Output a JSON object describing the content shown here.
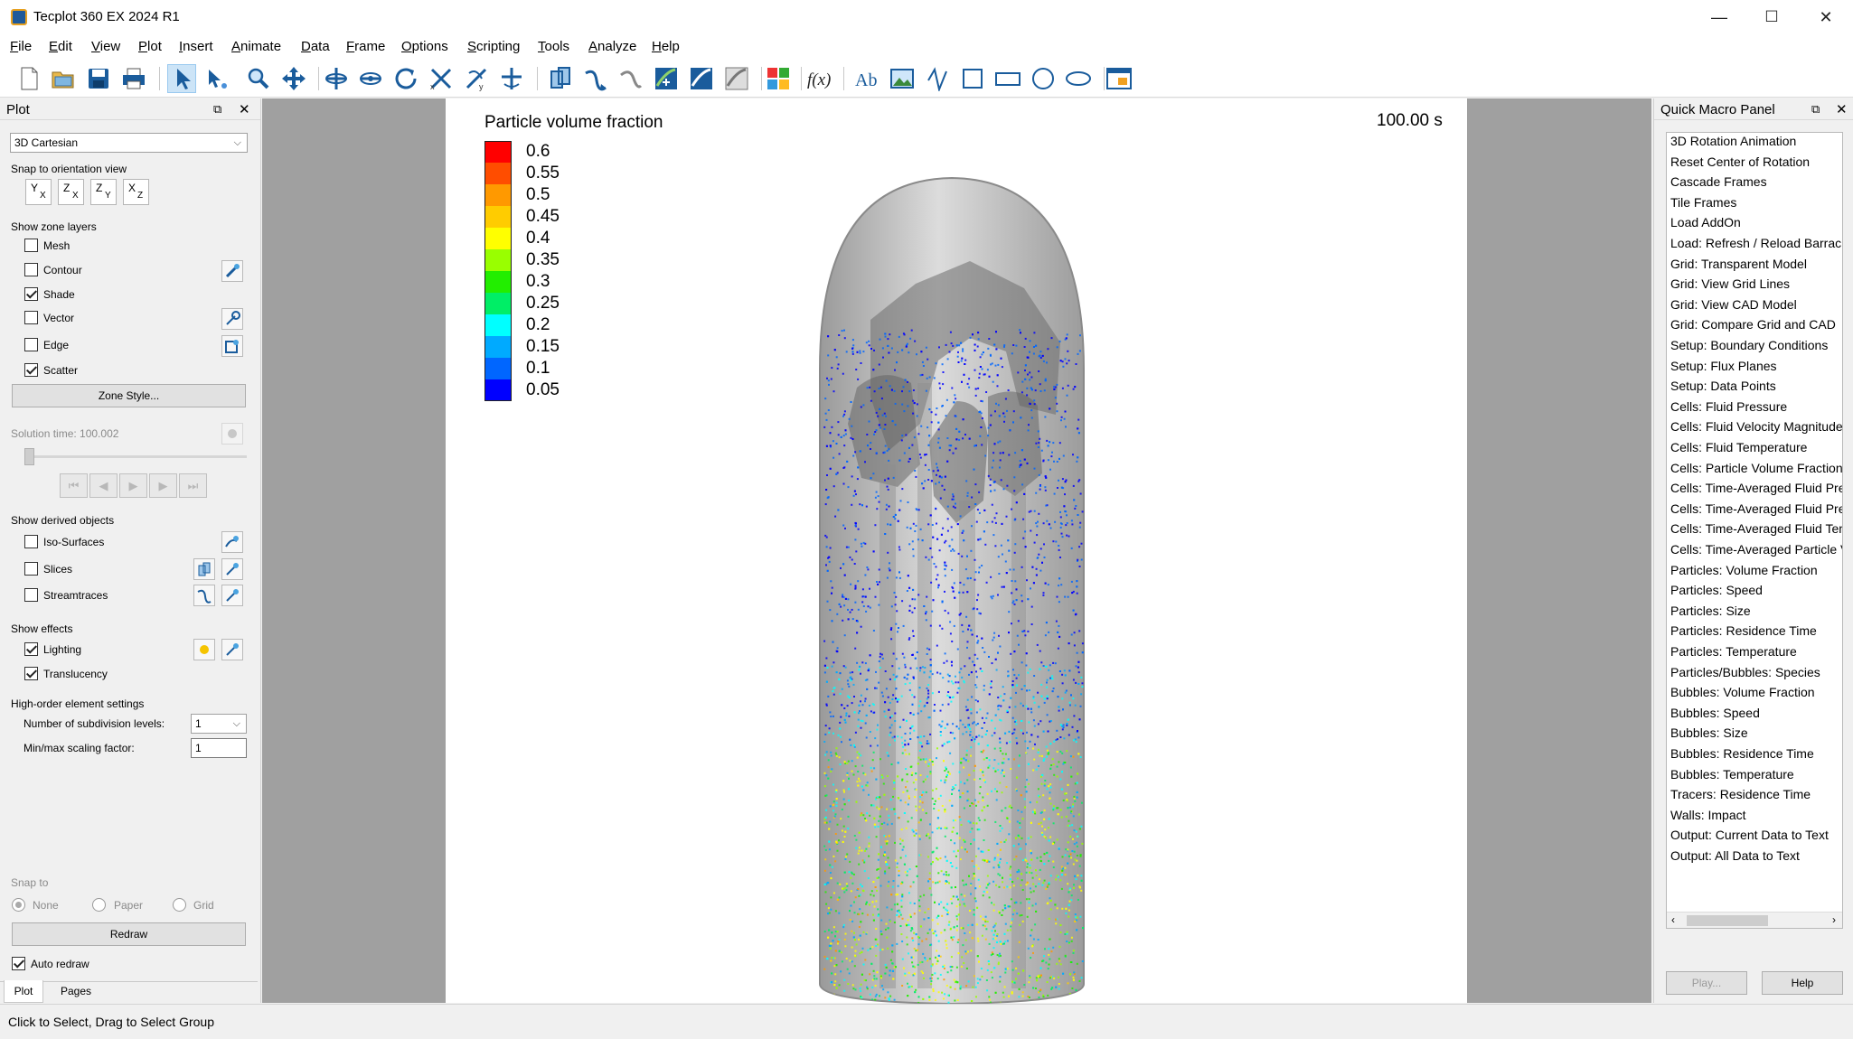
{
  "window": {
    "title": "Tecplot 360 EX 2024 R1",
    "minimize": "—",
    "maximize": "☐",
    "close": "✕"
  },
  "menu": [
    "File",
    "Edit",
    "View",
    "Plot",
    "Insert",
    "Animate",
    "Data",
    "Frame",
    "Options",
    "Scripting",
    "Tools",
    "Analyze",
    "Help"
  ],
  "toolbar": {
    "icons": [
      "new-layout-icon",
      "open-icon",
      "save-icon",
      "print-icon",
      "select-arrow-icon",
      "adjustor-icon",
      "zoom-icon",
      "translate-icon",
      "rotate-x-icon",
      "rotate-y-icon",
      "spherical-rotate-icon",
      "rollerball-icon",
      "twist-icon",
      "probe-icon",
      "slice-tool-icon",
      "streamtrace-icon",
      "streamtrace-rake-icon",
      "contour-add-icon",
      "contour-remove-icon",
      "contour-level-icon",
      "zone-effects-icon",
      "equation-icon",
      "text-icon",
      "image-icon",
      "polyline-icon",
      "square-icon",
      "rectangle-icon",
      "circle-icon",
      "ellipse-icon",
      "frame-icon"
    ]
  },
  "left_panel": {
    "title": "Plot",
    "plot_type": "3D Cartesian",
    "snap_orientation_label": "Snap to orientation view",
    "orientations": [
      {
        "a": "Y",
        "b": "X"
      },
      {
        "a": "Z",
        "b": "X"
      },
      {
        "a": "Z",
        "b": "Y"
      },
      {
        "a": "X",
        "b": "Z"
      }
    ],
    "zone_layers_label": "Show zone layers",
    "layers": {
      "mesh": "Mesh",
      "contour": "Contour",
      "shade": "Shade",
      "vector": "Vector",
      "edge": "Edge",
      "scatter": "Scatter"
    },
    "zone_style_button": "Zone Style...",
    "solution_time": "Solution time: 100.002",
    "derived_label": "Show derived objects",
    "derived": {
      "iso": "Iso-Surfaces",
      "slices": "Slices",
      "streamtraces": "Streamtraces"
    },
    "effects_label": "Show effects",
    "effects": {
      "lighting": "Lighting",
      "translucency": "Translucency"
    },
    "high_order_label": "High-order element settings",
    "subdivision_label": "Number of subdivision levels:",
    "subdivision_value": "1",
    "scaling_label": "Min/max scaling factor:",
    "scaling_value": "1",
    "snap_to_label": "Snap to",
    "snap_options": {
      "none": "None",
      "paper": "Paper",
      "grid": "Grid"
    },
    "redraw_button": "Redraw",
    "auto_redraw": "Auto redraw",
    "tabs": {
      "plot": "Plot",
      "pages": "Pages"
    }
  },
  "plot": {
    "legend_title": "Particle volume fraction",
    "legend_levels": [
      "0.6",
      "0.55",
      "0.5",
      "0.45",
      "0.4",
      "0.35",
      "0.3",
      "0.25",
      "0.2",
      "0.15",
      "0.1",
      "0.05"
    ],
    "legend_colors": [
      "#ff0000",
      "#ff4d00",
      "#ff9900",
      "#ffcc00",
      "#ffff00",
      "#99ff00",
      "#22ee00",
      "#00ee66",
      "#00ffff",
      "#00aaff",
      "#0066ff",
      "#0000ff"
    ],
    "time_label": "100.00 s"
  },
  "right_panel": {
    "title": "Quick Macro Panel",
    "macros": [
      "3D Rotation Animation",
      "Reset Center of Rotation",
      "Cascade Frames",
      "Tile Frames",
      "Load AddOn",
      "Load: Refresh / Reload Barracuda",
      "Grid: Transparent Model",
      "Grid: View Grid Lines",
      "Grid: View CAD Model",
      "Grid: Compare Grid and CAD",
      "Setup: Boundary Conditions",
      "Setup: Flux Planes",
      "Setup: Data Points",
      "Cells: Fluid Pressure",
      "Cells: Fluid Velocity Magnitude",
      "Cells: Fluid Temperature",
      "Cells: Particle Volume Fraction",
      "Cells: Time-Averaged Fluid Pressure",
      "Cells: Time-Averaged Fluid Pressure",
      "Cells: Time-Averaged Fluid Temperature",
      "Cells: Time-Averaged Particle Volume Fraction",
      "Particles: Volume Fraction",
      "Particles: Speed",
      "Particles: Size",
      "Particles: Residence Time",
      "Particles: Temperature",
      "Particles/Bubbles: Species",
      "Bubbles: Volume Fraction",
      "Bubbles: Speed",
      "Bubbles: Size",
      "Bubbles: Residence Time",
      "Bubbles: Temperature",
      "Tracers: Residence Time",
      "Walls: Impact",
      "Output: Current Data to Text",
      "Output: All Data to Text"
    ],
    "play_button": "Play...",
    "help_button": "Help"
  },
  "status": "Click to Select, Drag to Select Group"
}
